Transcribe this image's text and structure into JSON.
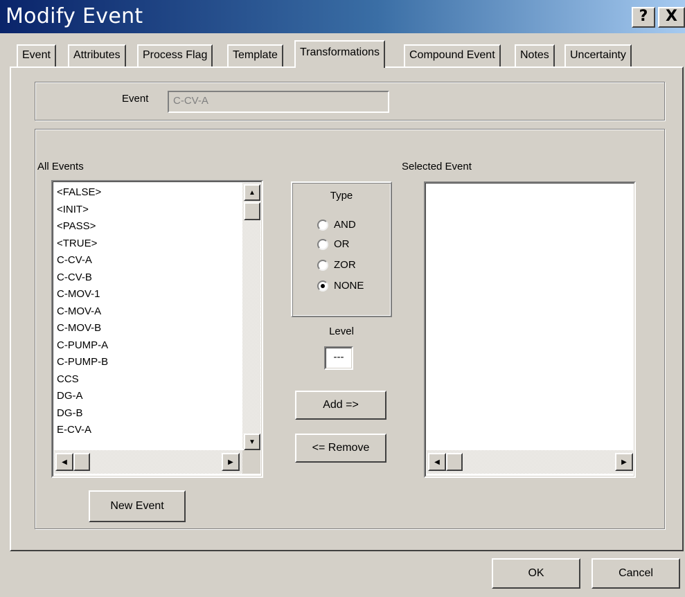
{
  "window": {
    "title": "Modify Event",
    "help_label": "?",
    "close_label": "X"
  },
  "tabs": [
    {
      "label": "Event"
    },
    {
      "label": "Attributes"
    },
    {
      "label": "Process Flag"
    },
    {
      "label": "Template"
    },
    {
      "label": "Transformations"
    },
    {
      "label": "Compound Event"
    },
    {
      "label": "Notes"
    },
    {
      "label": "Uncertainty"
    }
  ],
  "active_tab": "Transformations",
  "event_field": {
    "label": "Event",
    "value": "C-CV-A"
  },
  "all_events": {
    "label": "All Events",
    "items": [
      "<FALSE>",
      "<INIT>",
      "<PASS>",
      "<TRUE>",
      "C-CV-A",
      "C-CV-B",
      "C-MOV-1",
      "C-MOV-A",
      "C-MOV-B",
      "C-PUMP-A",
      "C-PUMP-B",
      "CCS",
      "DG-A",
      "DG-B",
      "E-CV-A"
    ]
  },
  "selected_event": {
    "label": "Selected Event",
    "items": []
  },
  "type_group": {
    "label": "Type",
    "options": [
      {
        "label": "AND",
        "checked": false
      },
      {
        "label": "OR",
        "checked": false
      },
      {
        "label": "ZOR",
        "checked": false
      },
      {
        "label": "NONE",
        "checked": true
      }
    ]
  },
  "level": {
    "label": "Level",
    "value": "---"
  },
  "buttons": {
    "add": "Add  =>",
    "remove": "<= Remove",
    "new_event": "New Event",
    "ok": "OK",
    "cancel": "Cancel"
  },
  "icons": {
    "scroll_up": "scroll-up-arrow-icon",
    "scroll_down": "scroll-down-arrow-icon",
    "scroll_left": "scroll-left-arrow-icon",
    "scroll_right": "scroll-right-arrow-icon"
  }
}
